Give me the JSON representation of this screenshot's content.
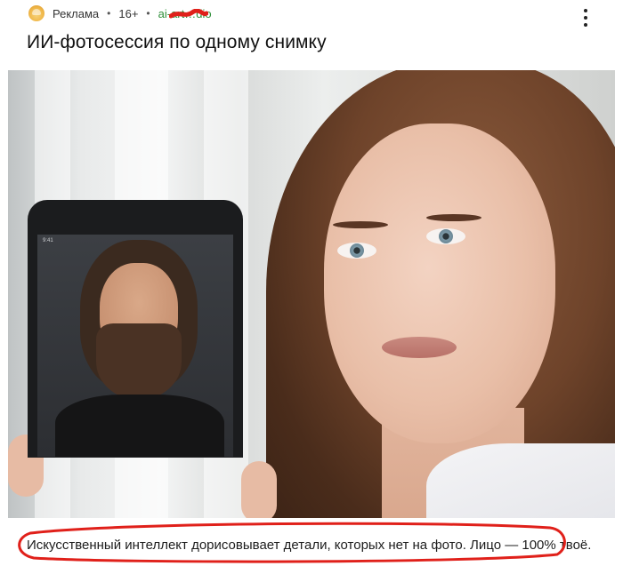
{
  "post": {
    "ad_label": "Реклама",
    "age_rating": "16+",
    "domain_link": "ai-art…dio",
    "title": "ИИ-фотосессия по одному снимку",
    "caption": "Искусственный интеллект дорисовывает детали, которых нет на фото. Лицо — 100% твоё.",
    "more_icon": "more-vertical-icon",
    "source_icon": "crown-emoji-icon"
  },
  "phone": {
    "status_time": "9:41"
  },
  "colors": {
    "domain_link": "#2f8f3a",
    "annotation_red": "#e0201a"
  }
}
